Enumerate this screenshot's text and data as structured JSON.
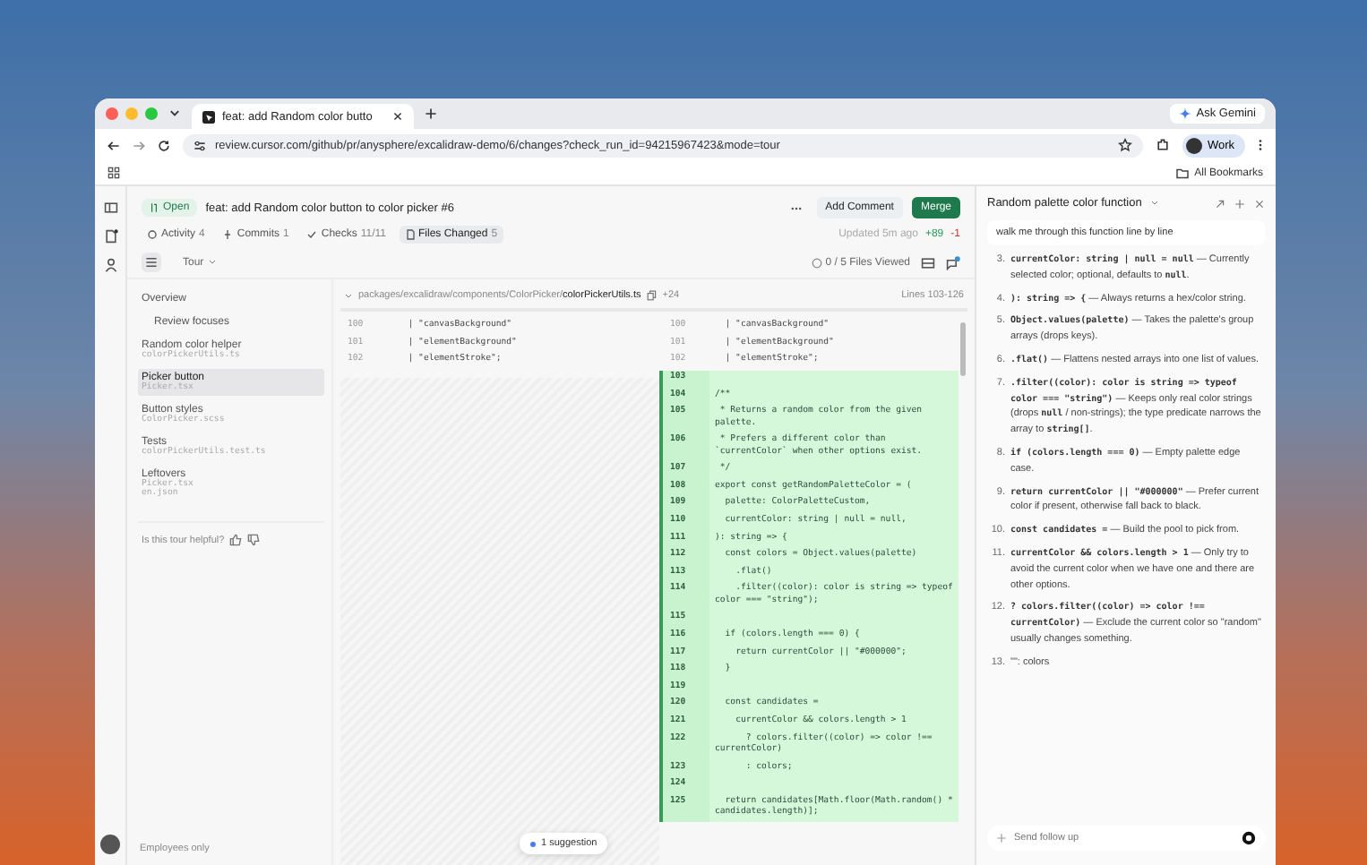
{
  "browser": {
    "tab_title": "feat: add Random color butto",
    "url": "review.cursor.com/github/pr/anysphere/excalidraw-demo/6/changes?check_run_id=94215967423&mode=tour",
    "profile": "Work",
    "ask_button": "Ask Gemini",
    "bookmarks": "All Bookmarks"
  },
  "pr": {
    "status": "Open",
    "title": "feat: add Random color button to color picker #6",
    "add_comment": "Add Comment",
    "merge": "Merge",
    "tabs": [
      {
        "label": "Activity",
        "count": "4",
        "kind": "activity",
        "selected": false
      },
      {
        "label": "Commits",
        "count": "1",
        "kind": "commits",
        "selected": false
      },
      {
        "label": "Checks",
        "count": "11/11",
        "kind": "checks",
        "selected": false
      },
      {
        "label": "Files Changed",
        "count": "5",
        "kind": "files",
        "selected": true
      }
    ],
    "updated": "Updated 5m ago",
    "additions": "+89",
    "deletions": "-1"
  },
  "toolbar": {
    "mode": "Tour",
    "files_viewed": "0 / 5 Files Viewed"
  },
  "tour": {
    "items": [
      {
        "title": "Overview",
        "selected": false,
        "children": [
          {
            "title": "Review focuses",
            "selected": false
          }
        ]
      },
      {
        "title": "Random color helper",
        "files": [
          "colorPickerUtils.ts"
        ],
        "selected": false
      },
      {
        "title": "Picker button",
        "files": [
          "Picker.tsx"
        ],
        "selected": true
      },
      {
        "title": "Button styles",
        "files": [
          "ColorPicker.scss"
        ],
        "selected": false
      },
      {
        "title": "Tests",
        "files": [
          "colorPickerUtils.test.ts"
        ],
        "selected": false
      },
      {
        "title": "Leftovers",
        "files": [
          "Picker.tsx",
          "en.json"
        ],
        "selected": false
      }
    ],
    "feedback": "Is this tour helpful?"
  },
  "user": {
    "label": "Employees only"
  },
  "diff": {
    "path": "packages/excalidraw/components/ColorPicker/",
    "file": "colorPickerUtils.ts",
    "added": "+24",
    "range": "Lines 103-126",
    "suggestions": "1 suggestion",
    "left_lines": [
      {
        "num": "100",
        "text": "  | \"canvasBackground\""
      },
      {
        "num": "101",
        "text": "  | \"elementBackground\""
      },
      {
        "num": "102",
        "text": "  | \"elementStroke\";"
      }
    ],
    "right_lines": [
      {
        "num": "100",
        "text": "  | \"canvasBackground\"",
        "kind": "context"
      },
      {
        "num": "101",
        "text": "  | \"elementBackground\"",
        "kind": "context"
      },
      {
        "num": "102",
        "text": "  | \"elementStroke\";",
        "kind": "context"
      },
      {
        "num": "103",
        "kind": "added"
      },
      {
        "num": "104",
        "text": "/**",
        "kind": "added"
      },
      {
        "num": "105",
        "text": " * Returns a random color from the given palette.",
        "kind": "added"
      },
      {
        "num": "106",
        "text": " * Prefers a different color than `currentColor` when other options exist.",
        "kind": "added"
      },
      {
        "num": "107",
        "text": " */",
        "kind": "added"
      },
      {
        "num": "108",
        "text": "export const getRandomPaletteColor = (",
        "kind": "added"
      },
      {
        "num": "109",
        "text": "  palette: ColorPaletteCustom,",
        "kind": "added"
      },
      {
        "num": "110",
        "text": "  currentColor: string | null = null,",
        "kind": "added"
      },
      {
        "num": "111",
        "text": "): string => {",
        "kind": "added"
      },
      {
        "num": "112",
        "text": "  const colors = Object.values(palette)",
        "kind": "added"
      },
      {
        "num": "113",
        "text": "    .flat()",
        "kind": "added"
      },
      {
        "num": "114",
        "text": "    .filter((color): color is string => typeof color === \"string\");",
        "kind": "added"
      },
      {
        "num": "115",
        "kind": "added"
      },
      {
        "num": "116",
        "text": "  if (colors.length === 0) {",
        "kind": "added"
      },
      {
        "num": "117",
        "text": "    return currentColor || \"#000000\";",
        "kind": "added"
      },
      {
        "num": "118",
        "text": "  }",
        "kind": "added"
      },
      {
        "num": "119",
        "kind": "added"
      },
      {
        "num": "120",
        "text": "  const candidates =",
        "kind": "added"
      },
      {
        "num": "121",
        "text": "    currentColor && colors.length > 1",
        "kind": "added"
      },
      {
        "num": "122",
        "text": "      ? colors.filter((color) => color !== currentColor)",
        "kind": "added"
      },
      {
        "num": "123",
        "text": "      : colors;",
        "kind": "added"
      },
      {
        "num": "124",
        "kind": "added"
      },
      {
        "num": "125",
        "text": "  return candidates[Math.floor(Math.random() * candidates.length)];",
        "kind": "added"
      }
    ]
  },
  "chat": {
    "title": "Random palette color function",
    "user_message": "walk me through this function line by line",
    "placeholder": "Send follow up",
    "items": [
      {
        "number": "3.",
        "text": "**currentColor: string | null = null** — Currently selected color; optional, defaults to **null**."
      },
      {
        "number": "4.",
        "text": "**): string => {** — Always returns a hex/color string."
      },
      {
        "number": "5.",
        "text": "**Object.values(palette)** — Takes the palette's group arrays (drops keys)."
      },
      {
        "number": "6.",
        "text": "**.flat()** — Flattens nested arrays into one list of values."
      },
      {
        "number": "7.",
        "text": "**.filter((color): color is string => typeof color === \"string\")** — Keeps only real color strings (drops **null** / non-strings); the type predicate narrows the array to **string[]**."
      },
      {
        "number": "8.",
        "text": "**if (colors.length === 0)** — Empty palette edge case."
      },
      {
        "number": "9.",
        "text": "**return currentColor || \"#000000\"** — Prefer current color if present, otherwise fall back to black."
      },
      {
        "number": "10.",
        "text": "**const candidates =** — Build the pool to pick from."
      },
      {
        "number": "11.",
        "text": "**currentColor && colors.length > 1** — Only try to avoid the current color when we have one and there are other options."
      },
      {
        "number": "12.",
        "text": "**? colors.filter((color) => color !== currentColor)** — Exclude the current color so \"random\" usually changes something."
      },
      {
        "number": "13.",
        "text": "\"\": colors"
      }
    ]
  }
}
